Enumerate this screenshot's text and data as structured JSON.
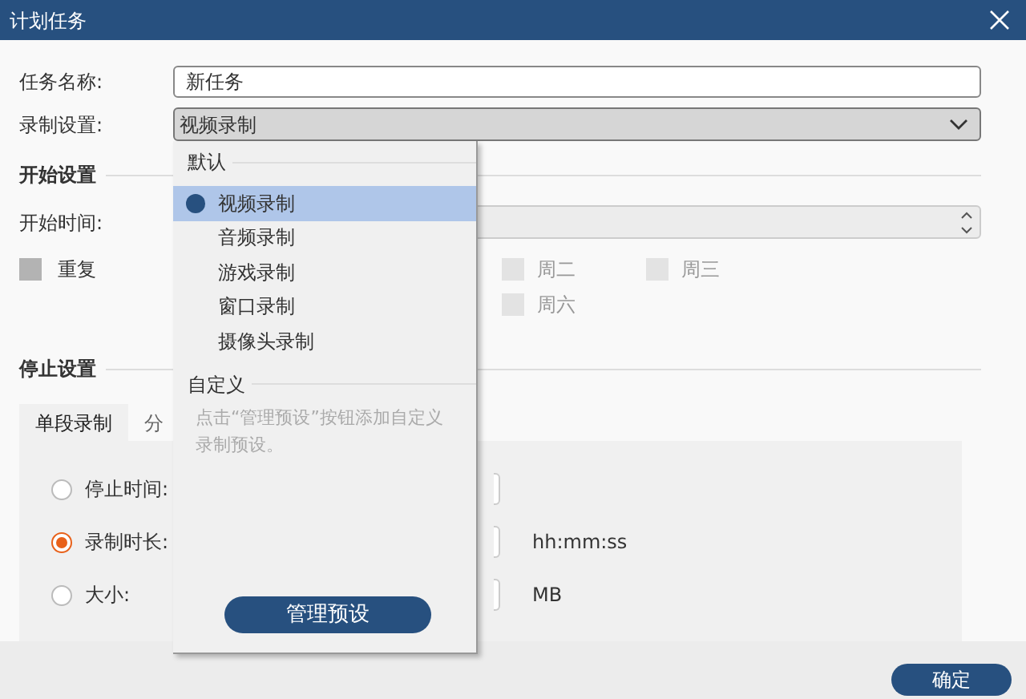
{
  "window": {
    "title": "计划任务"
  },
  "form": {
    "task_name": {
      "label": "任务名称:",
      "value": "新任务"
    },
    "recording_setting": {
      "label": "录制设置:",
      "value": "视频录制",
      "expanded": true
    }
  },
  "start_section": {
    "title": "开始设置",
    "start_time": {
      "label": "开始时间:",
      "disabled": true
    },
    "repeat": {
      "label": "重复",
      "checked": false
    },
    "weekdays": [
      {
        "label": "周二",
        "checked": false
      },
      {
        "label": "周三",
        "checked": false
      },
      {
        "label": "周六",
        "checked": false
      }
    ]
  },
  "stop_section": {
    "title": "停止设置",
    "tabs": [
      {
        "label": "单段录制",
        "selected": true
      },
      {
        "label": "分",
        "selected": false
      }
    ],
    "options": [
      {
        "label": "停止时间:",
        "selected": false
      },
      {
        "label": "录制时长:",
        "selected": true,
        "unit": "hh:mm:ss"
      },
      {
        "label": "大小:",
        "selected": false,
        "unit": "MB"
      }
    ]
  },
  "dropdown": {
    "default_title": "默认",
    "items": [
      {
        "label": "视频录制",
        "selected": true
      },
      {
        "label": "音频录制",
        "selected": false
      },
      {
        "label": "游戏录制",
        "selected": false
      },
      {
        "label": "窗口录制",
        "selected": false
      },
      {
        "label": "摄像头录制",
        "selected": false
      }
    ],
    "custom_title": "自定义",
    "hint": "点击“管理预设”按钮添加自定义录制预设。",
    "button": "管理预设"
  },
  "footer": {
    "ok_button": "确定"
  }
}
